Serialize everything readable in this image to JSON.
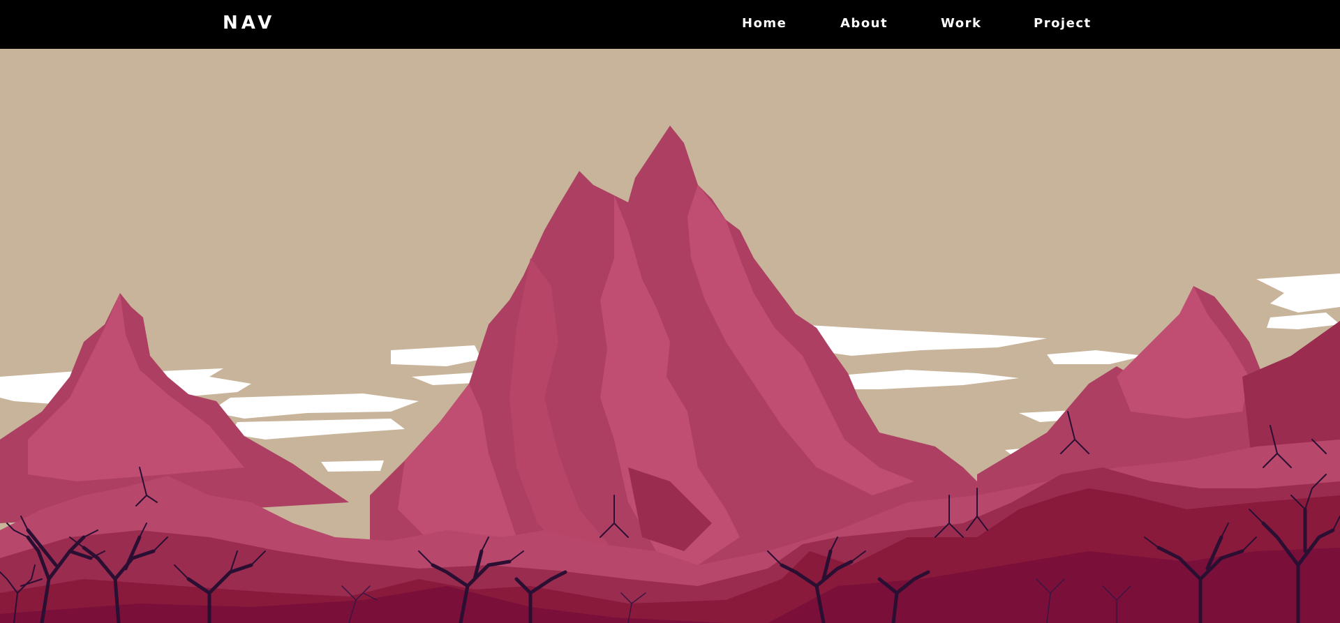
{
  "brand": "NAV",
  "nav": {
    "items": [
      {
        "label": "Home"
      },
      {
        "label": "About"
      },
      {
        "label": "Work"
      },
      {
        "label": "Project"
      }
    ]
  },
  "colors": {
    "navbar": "#000000",
    "sky": "#c8b49a",
    "cloud": "#ffffff",
    "mountain_light": "#c04d72",
    "mountain_mid": "#ad3f62",
    "mountain_dark": "#8a1a3c",
    "foreground": "#7a0f3a",
    "trees": "#2a0f33"
  }
}
